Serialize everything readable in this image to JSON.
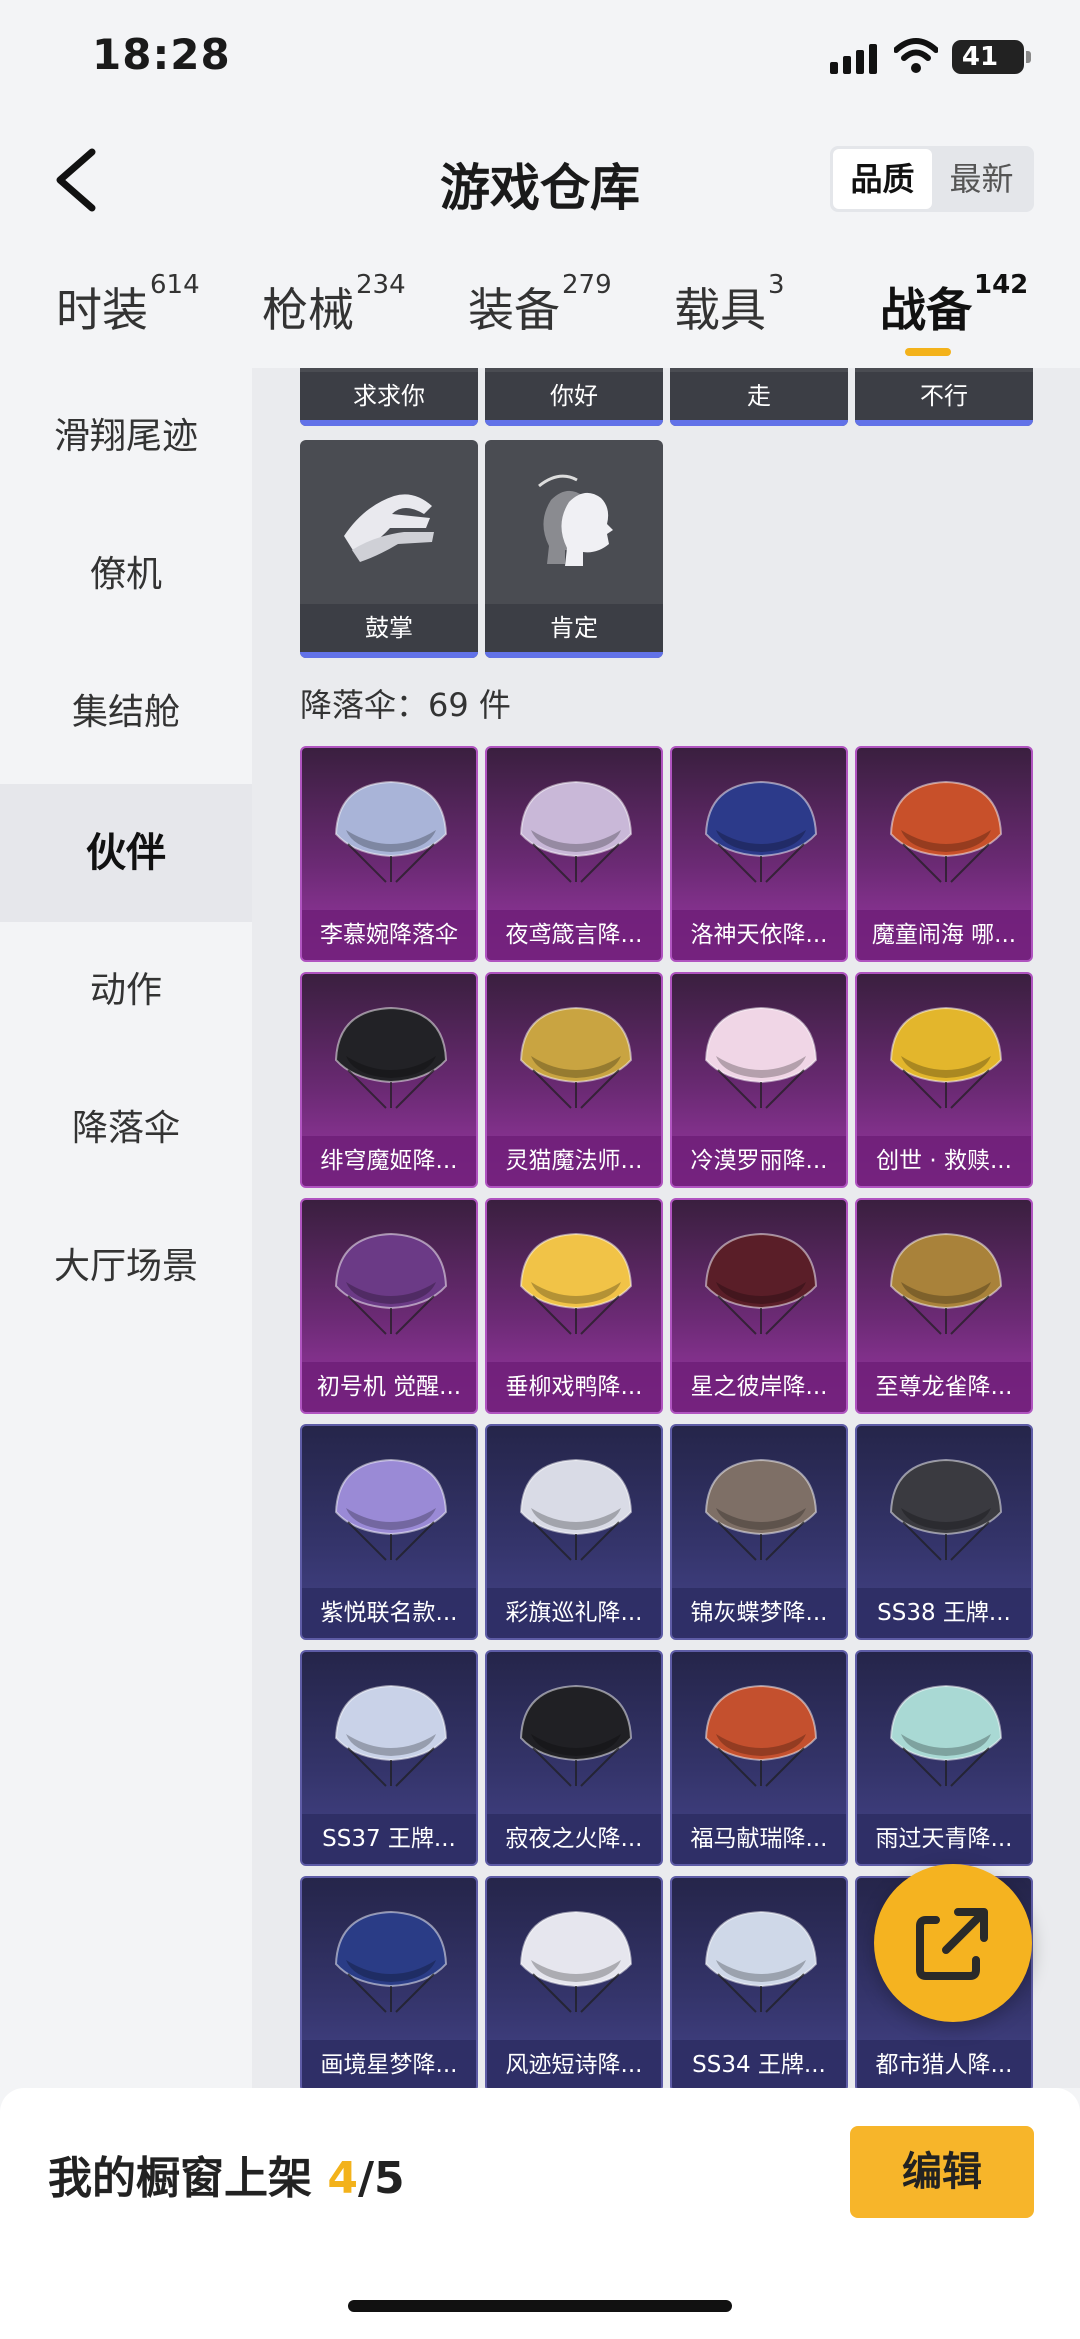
{
  "status_bar": {
    "time": "18:28",
    "battery": "41"
  },
  "header": {
    "title": "游戏仓库",
    "sort_options": [
      "品质",
      "最新"
    ],
    "active_sort": "品质"
  },
  "tabs": [
    {
      "label": "时装",
      "count": "614"
    },
    {
      "label": "枪械",
      "count": "234"
    },
    {
      "label": "装备",
      "count": "279"
    },
    {
      "label": "载具",
      "count": "3"
    },
    {
      "label": "战备",
      "count": "142"
    }
  ],
  "active_tab": "战备",
  "sidebar": {
    "items": [
      "滑翔尾迹",
      "僚机",
      "集结舱",
      "伙伴",
      "动作",
      "降落伞",
      "大厅场景"
    ],
    "active": "伙伴"
  },
  "emotes": {
    "row1": [
      "求求你",
      "你好",
      "走",
      "不行"
    ],
    "row2": [
      {
        "label": "鼓掌",
        "icon": "clapping-hands-icon"
      },
      {
        "label": "肯定",
        "icon": "nodding-head-icon"
      }
    ]
  },
  "parachute_section": {
    "label": "降落伞：69 件"
  },
  "parachutes": [
    {
      "name": "李慕婉降落伞",
      "rarity": "purple",
      "color": "#a9b4d8"
    },
    {
      "name": "夜鸢箴言降...",
      "rarity": "purple",
      "color": "#c9b8d8"
    },
    {
      "name": "洛神天依降...",
      "rarity": "purple",
      "color": "#2c3a8a"
    },
    {
      "name": "魔童闹海 哪...",
      "rarity": "purple",
      "color": "#c8502a"
    },
    {
      "name": "绯穹魔姬降...",
      "rarity": "purple",
      "color": "#222226"
    },
    {
      "name": "灵猫魔法师...",
      "rarity": "purple",
      "color": "#c9a441"
    },
    {
      "name": "冷漠罗丽降...",
      "rarity": "purple",
      "color": "#f0d6e6"
    },
    {
      "name": "创世 · 救赎...",
      "rarity": "purple",
      "color": "#e3b62c"
    },
    {
      "name": "初号机 觉醒...",
      "rarity": "purple",
      "color": "#6b3a86"
    },
    {
      "name": "垂柳戏鸭降...",
      "rarity": "purple",
      "color": "#f1c347"
    },
    {
      "name": "星之彼岸降...",
      "rarity": "purple",
      "color": "#5a1e28"
    },
    {
      "name": "至尊龙雀降...",
      "rarity": "purple",
      "color": "#a9823a"
    },
    {
      "name": "紫悦联名款...",
      "rarity": "blue",
      "color": "#9a8ad6"
    },
    {
      "name": "彩旗巡礼降...",
      "rarity": "blue",
      "color": "#d9dbe6"
    },
    {
      "name": "锦灰蝶梦降...",
      "rarity": "blue",
      "color": "#7e6f66"
    },
    {
      "name": "SS38 王牌...",
      "rarity": "blue",
      "color": "#3a3a40"
    },
    {
      "name": "SS37 王牌...",
      "rarity": "blue",
      "color": "#c9d2e8"
    },
    {
      "name": "寂夜之火降...",
      "rarity": "blue",
      "color": "#202024"
    },
    {
      "name": "福马献瑞降...",
      "rarity": "blue",
      "color": "#c4502e"
    },
    {
      "name": "雨过天青降...",
      "rarity": "blue",
      "color": "#a9d9d4"
    },
    {
      "name": "画境星梦降...",
      "rarity": "blue",
      "color": "#2a3c86"
    },
    {
      "name": "风迹短诗降...",
      "rarity": "blue",
      "color": "#e6e6ee"
    },
    {
      "name": "SS34 王牌...",
      "rarity": "blue",
      "color": "#cfd8e8"
    },
    {
      "name": "都市猎人降...",
      "rarity": "blue",
      "color": "#555566"
    }
  ],
  "footer": {
    "label": "我的橱窗上架",
    "count": "4",
    "total": "/5",
    "edit_label": "编辑"
  },
  "colors": {
    "accent": "#f3b21b",
    "purple_rarity": "#9c38a6",
    "blue_rarity": "#45448a"
  }
}
